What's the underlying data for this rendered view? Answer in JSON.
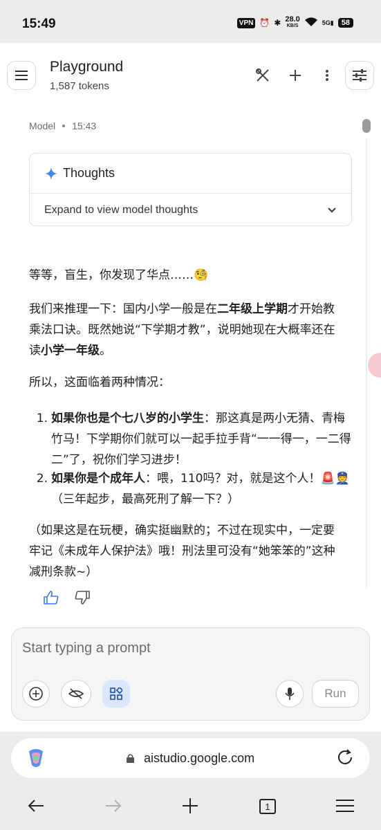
{
  "status_bar": {
    "time": "15:49",
    "vpn": "VPN",
    "net_speed": "28.0",
    "net_unit": "KB/S",
    "signal": "5G",
    "battery": "58"
  },
  "header": {
    "title": "Playground",
    "tokens": "1,587 tokens"
  },
  "message": {
    "role": "Model",
    "time": "15:43",
    "thoughts_label": "Thoughts",
    "thoughts_expand": "Expand to view model thoughts",
    "p1": "等等，盲生，你发现了华点……🧐",
    "p2_a": "我们来推理一下：国内小学一般是在",
    "p2_b": "二年级上学期",
    "p2_c": "才开始教乘法口诀。既然她说“下学期才教”，说明她现在大概率还在读",
    "p2_d": "小学一年级",
    "p2_e": "。",
    "p3": "所以，这面临着两种情况：",
    "li1_num": "1.",
    "li1_bold": "如果你也是个七八岁的小学生",
    "li1_rest": "：那这真是两小无猜、青梅竹马！下学期你们就可以一起手拉手背“一一得一，一二得二”了，祝你们学习进步！",
    "li2_num": "2.",
    "li2_bold": "如果你是个成年人",
    "li2_rest": "：喂，110吗？对，就是这个人！🚨👮（三年起步，最高死刑了解一下？）",
    "p4": "（如果这是在玩梗，确实挺幽默的；不过在现实中，一定要牢记《未成年人保护法》哦！刑法里可没有“她笨笨的”这种减刑条款~）"
  },
  "prompt": {
    "placeholder": "Start typing a prompt",
    "run_label": "Run"
  },
  "browser": {
    "url": "aistudio.google.com",
    "tab_count": "1"
  },
  "colors": {
    "accent_blue": "#d9e6fb",
    "thoughts_star": "#4285f4"
  }
}
